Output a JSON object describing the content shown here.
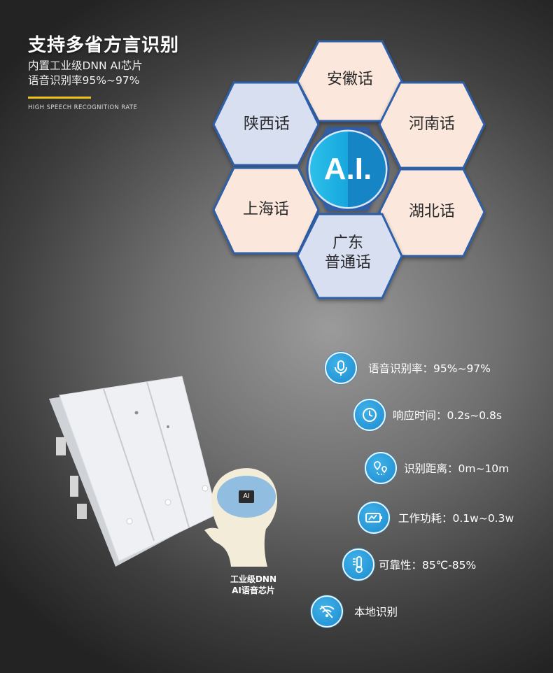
{
  "header": {
    "title": "支持多省方言识别",
    "subtitle_lines": [
      "内置工业级DNN AI芯片",
      "语音识别率95%~97%"
    ],
    "caption": "HIGH SPEECH RECOGNITION RATE"
  },
  "hexagons": {
    "center": "A.I.",
    "dialects": {
      "anhui": "安徽话",
      "shaanxi": "陕西话",
      "henan": "河南话",
      "shanghai": "上海话",
      "hubei": "湖北话",
      "guangdong_line1": "广东",
      "guangdong_line2": "普通话"
    }
  },
  "features": [
    {
      "label": "语音识别率：95%~97%",
      "icon": "microphone-icon"
    },
    {
      "label": "响应时间：0.2s~0.8s",
      "icon": "clock-icon"
    },
    {
      "label": "识别距离：0m~10m",
      "icon": "location-pins-icon"
    },
    {
      "label": "工作功耗：0.1w~0.3w",
      "icon": "battery-icon"
    },
    {
      "label": "可靠性：85℃-85%",
      "icon": "thermometer-icon"
    },
    {
      "label": "本地识别",
      "icon": "wifi-off-icon"
    }
  ],
  "chip": {
    "badge": "AI",
    "caption_line1": "工业级DNN",
    "caption_line2": "AI语音芯片"
  },
  "colors": {
    "accent": "#f0c21b",
    "hex_blue": "#d7dff1",
    "hex_peach": "#fbe7dc",
    "hex_border": "#2f5ea8",
    "icon_blue": "#1d8bcf",
    "ai_blue": "#18a7dd"
  }
}
